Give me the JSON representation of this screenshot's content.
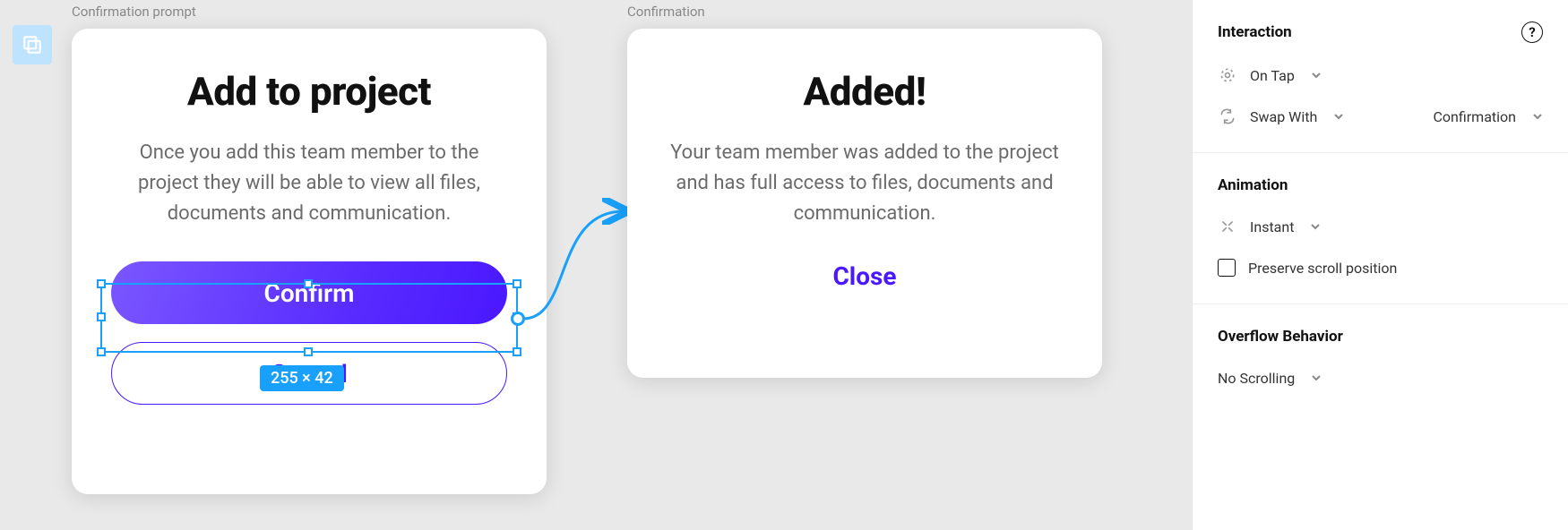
{
  "canvas": {
    "frame1": {
      "label": "Confirmation prompt",
      "title": "Add to project",
      "body": "Once you add this team member to the project they will be able to view all files, documents and communication.",
      "confirm": "Confirm",
      "cancel": "Cancel",
      "selection_dims": "255 × 42"
    },
    "frame2": {
      "label": "Confirmation",
      "title": "Added!",
      "body": "Your team member was added to the project and has full access to files, documents and communication.",
      "close": "Close"
    }
  },
  "panel": {
    "interaction": {
      "title": "Interaction",
      "trigger": {
        "label": "On Tap"
      },
      "action": {
        "label": "Swap With",
        "target": "Confirmation"
      }
    },
    "animation": {
      "title": "Animation",
      "type": "Instant",
      "preserve_scroll": "Preserve scroll position"
    },
    "overflow": {
      "title": "Overflow Behavior",
      "mode": "No Scrolling"
    }
  }
}
